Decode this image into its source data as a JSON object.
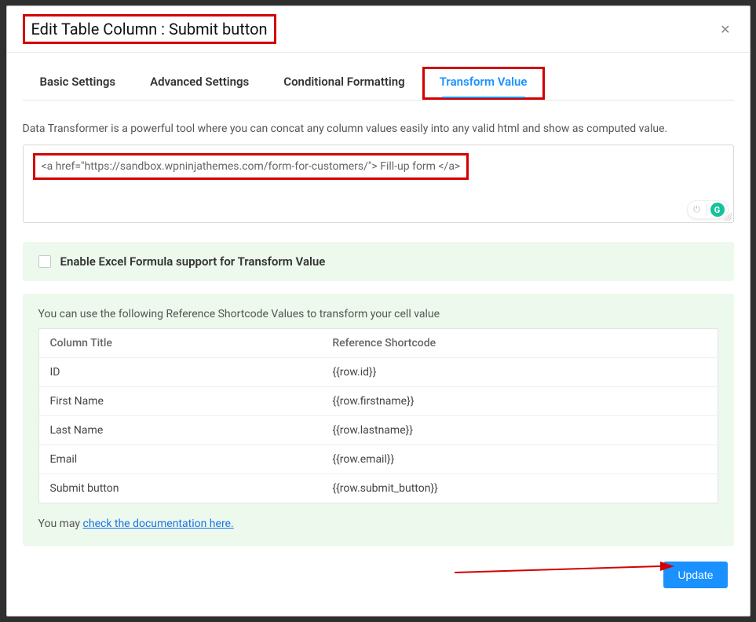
{
  "header": {
    "title": "Edit Table Column : Submit button",
    "close_label": "✕"
  },
  "tabs": {
    "items": [
      {
        "label": "Basic Settings",
        "active": false
      },
      {
        "label": "Advanced Settings",
        "active": false
      },
      {
        "label": "Conditional Formatting",
        "active": false
      },
      {
        "label": "Transform Value",
        "active": true
      }
    ]
  },
  "description": "Data Transformer is a powerful tool where you can concat any column values easily into any valid html and show as computed value.",
  "transform": {
    "value": "<a href=\"https://sandbox.wpninjathemes.com/form-for-customers/\"> Fill-up form </a>"
  },
  "formula": {
    "label": "Enable Excel Formula support for Transform Value",
    "checked": false
  },
  "reference": {
    "intro": "You can use the following Reference Shortcode Values to transform your cell value",
    "columns": [
      "Column Title",
      "Reference Shortcode"
    ],
    "rows": [
      {
        "title": "ID",
        "shortcode": "{{row.id}}"
      },
      {
        "title": "First Name",
        "shortcode": "{{row.firstname}}"
      },
      {
        "title": "Last Name",
        "shortcode": "{{row.lastname}}"
      },
      {
        "title": "Email",
        "shortcode": "{{row.email}}"
      },
      {
        "title": "Submit button",
        "shortcode": "{{row.submit_button}}"
      }
    ],
    "doc_prefix": "You may ",
    "doc_link": "check the documentation here."
  },
  "footer": {
    "update_label": "Update"
  },
  "icons": {
    "grammarly": "G",
    "power": "⏻"
  }
}
